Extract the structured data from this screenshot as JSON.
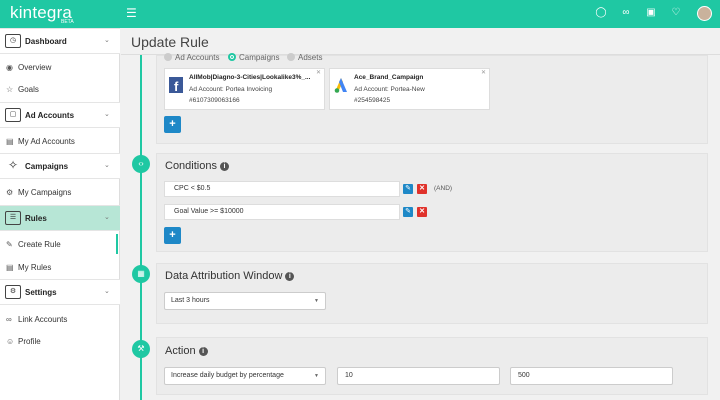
{
  "topbar": {
    "logo": "kintegra",
    "beta": "BETA",
    "icons": [
      "zoom-icon",
      "link-icon",
      "briefcase-icon",
      "bell-icon",
      "avatar"
    ]
  },
  "sidebar": {
    "dashboard": "Dashboard",
    "overview": "Overview",
    "goals": "Goals",
    "ad_accounts": "Ad Accounts",
    "my_ad_accounts": "My Ad Accounts",
    "campaigns": "Campaigns",
    "my_campaigns": "My Campaigns",
    "rules": "Rules",
    "create_rule": "Create Rule",
    "my_rules": "My Rules",
    "settings": "Settings",
    "link_accounts": "Link Accounts",
    "profile": "Profile"
  },
  "page": {
    "title": "Update Rule"
  },
  "target": {
    "options": [
      "Ad Accounts",
      "Campaigns",
      "Adsets"
    ],
    "selected": "Campaigns",
    "cards": [
      {
        "name": "AllMob|Diagno-3-Cities|Lookalike3%_...",
        "account": "Ad Account:  Portea Invoicing",
        "id": "#6107309063166",
        "logo": "facebook"
      },
      {
        "name": "Ace_Brand_Campaign",
        "account": "Ad Account:  Portea-New",
        "id": "#254598425",
        "logo": "google-ads"
      }
    ]
  },
  "conditions": {
    "title": "Conditions",
    "items": [
      "CPC  <  $0.5",
      "Goal Value  >=  $10000"
    ],
    "joiner": "(AND)"
  },
  "attribution": {
    "title": "Data Attribution Window",
    "value": "Last 3 hours"
  },
  "action": {
    "title": "Action",
    "type": "Increase daily budget by percentage",
    "value1": "10",
    "value2": "500"
  },
  "colors": {
    "accent": "#1fc8a3",
    "primary": "#1e88c7",
    "danger": "#e0322b"
  }
}
